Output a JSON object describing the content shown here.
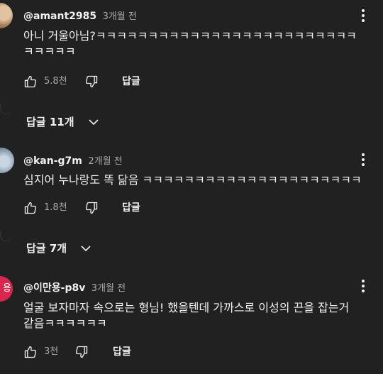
{
  "comments": [
    {
      "author": "@amant2985",
      "time": "3개월 전",
      "text_line1": "아니 거울아님?ㅋㅋㅋㅋㅋㅋㅋㅋㅋㅋㅋㅋㅋㅋㅋㅋㅋㅋㅋㅋㅋㅋㅋㅋㅋ",
      "text_line2": "ㅋㅋㅋㅋㅋ",
      "likes": "5.8천",
      "reply_label": "답글",
      "replies_toggle": "답글 11개"
    },
    {
      "author": "@kan-g7m",
      "time": "2개월 전",
      "text_line1": "심지어 누나랑도 똑 닮음 ㅋㅋㅋㅋㅋㅋㅋㅋㅋㅋㅋㅋㅋㅋㅋㅋㅋㅋㅋㅋㅋ",
      "likes": "1.8천",
      "reply_label": "답글",
      "replies_toggle": "답글 7개"
    },
    {
      "author": "@이만용-p8v",
      "time": "3개월 전",
      "avatar_text": "용",
      "text_line1": "얼굴 보자마자 속으로는 형님! 했을텐데 가까스로 이성의 끈을 잡는거",
      "text_line2": "같음ㅋㅋㅋㅋㅋㅋ",
      "likes": "3천",
      "reply_label": "답글"
    }
  ],
  "icons": {
    "like": "thumbs-up-outline-icon",
    "dislike": "thumbs-down-outline-icon",
    "more": "vertical-ellipsis-icon",
    "chevron": "chevron-down-icon"
  },
  "colors": {
    "background": "#212121",
    "primary_text": "#f1f1f1",
    "secondary_text": "#aaaaaa",
    "avatar_3": "#d9264e"
  }
}
